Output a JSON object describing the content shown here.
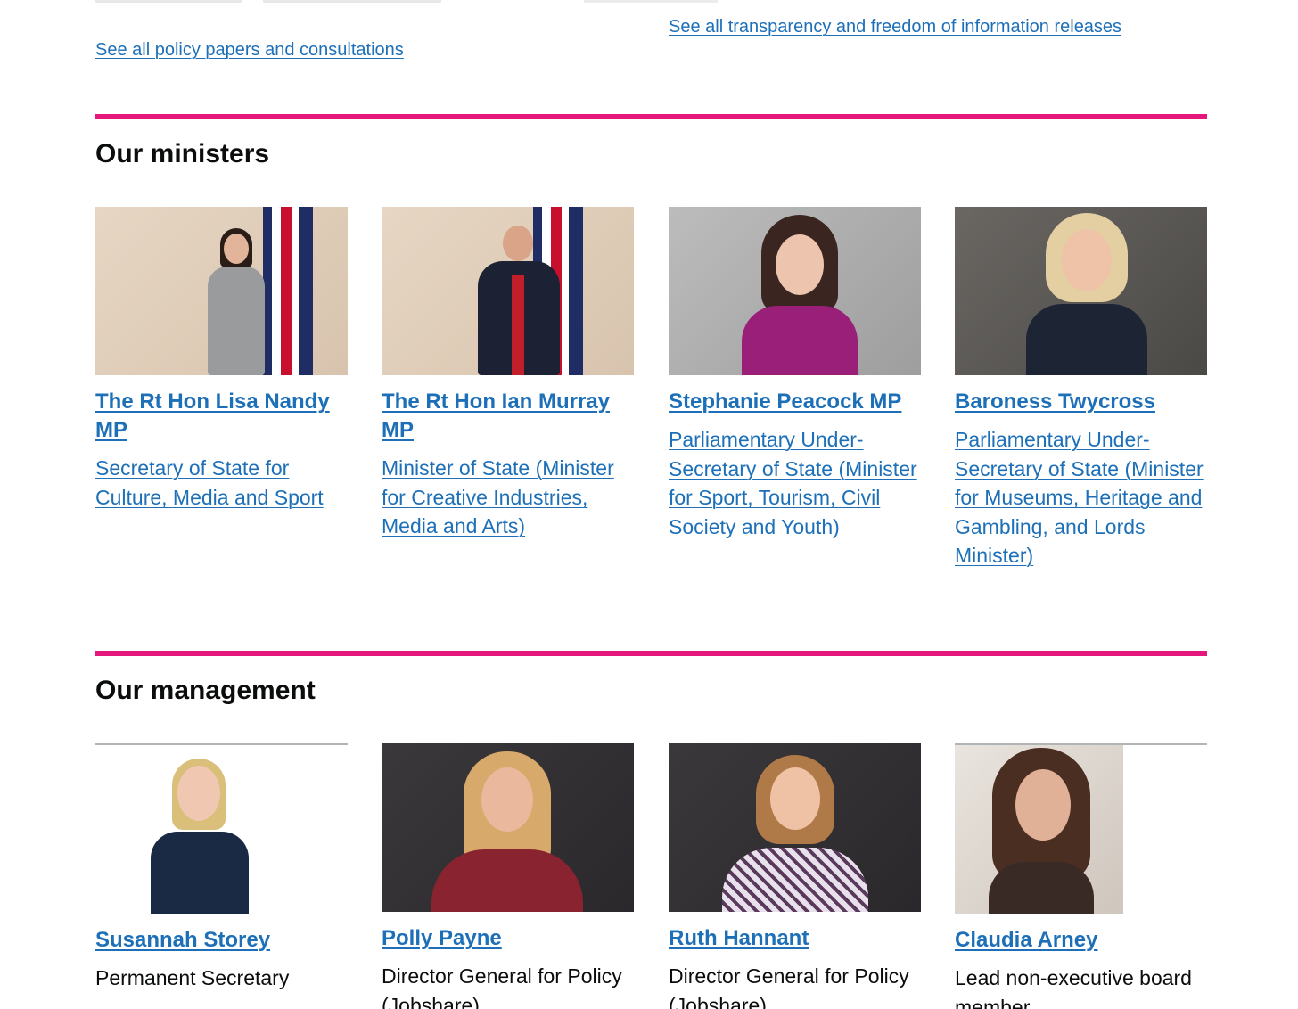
{
  "top_links": {
    "policy": "See all policy papers and consultations",
    "transparency": "See all transparency and freedom of information releases"
  },
  "ministers": {
    "heading": "Our ministers",
    "people": [
      {
        "name": "The Rt Hon Lisa Nandy MP",
        "role": "Secretary of State for Culture, Media and Sport"
      },
      {
        "name": "The Rt Hon Ian Murray MP",
        "role": "Minister of State (Minister for Creative Industries, Media and Arts)"
      },
      {
        "name": "Stephanie Peacock MP",
        "role": "Parliamentary Under-Secretary of State (Minister for Sport, Tourism, Civil Society and Youth)"
      },
      {
        "name": "Baroness Twycross",
        "role": "Parliamentary Under-Secretary of State (Minister for Museums, Heritage and Gambling, and Lords Minister)"
      }
    ]
  },
  "management": {
    "heading": "Our management",
    "people": [
      {
        "name": "Susannah Storey",
        "role": "Permanent Secretary"
      },
      {
        "name": "Polly Payne",
        "role": "Director General for Policy (Jobshare)"
      },
      {
        "name": "Ruth Hannant",
        "role": "Director General for Policy (Jobshare)"
      },
      {
        "name": "Claudia Arney",
        "role": "Lead non-executive board member"
      }
    ]
  },
  "colors": {
    "link": "#1d70b8",
    "section_rule": "#e3177c",
    "text": "#0b0c0c"
  }
}
